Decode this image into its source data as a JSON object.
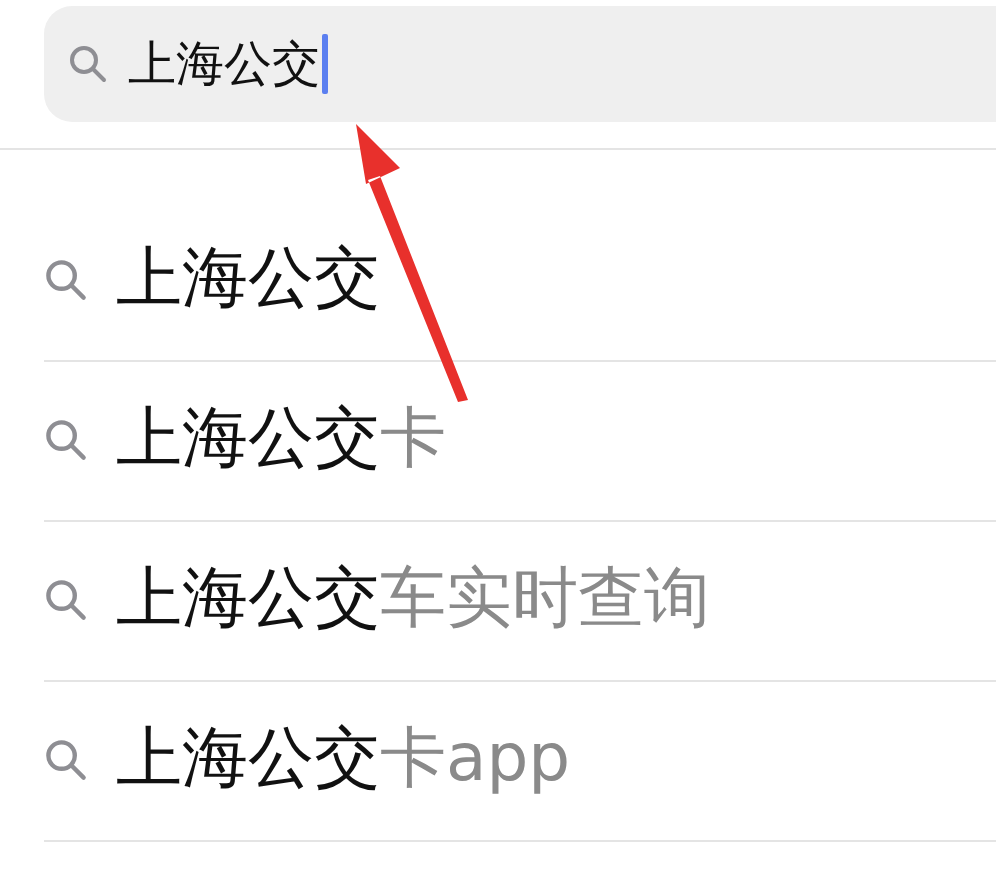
{
  "search": {
    "value": "上海公交",
    "focused": true
  },
  "suggestions": [
    {
      "match": "上海公交"
    },
    {
      "match": "上海公交",
      "rest": "卡"
    },
    {
      "match": "上海公交",
      "rest": "车实时查询"
    },
    {
      "match": "上海公交",
      "rest": "卡app"
    }
  ]
}
